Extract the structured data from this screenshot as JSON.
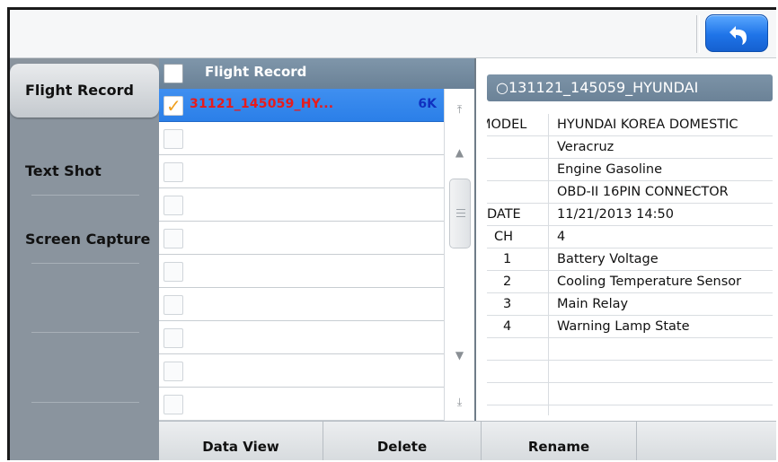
{
  "sidebar": {
    "tabs": [
      {
        "label": "Flight Record",
        "active": true
      },
      {
        "label": "Text Shot",
        "active": false
      },
      {
        "label": "Screen Capture",
        "active": false
      }
    ]
  },
  "list": {
    "header_title": "Flight Record",
    "selected_item": {
      "name": "31121_145059_HY...",
      "size": "6K",
      "checked": true
    }
  },
  "detail": {
    "title": "131121_145059_HYUNDAI",
    "rows": [
      {
        "label": "MODEL",
        "value": "HYUNDAI KOREA DOMESTIC"
      },
      {
        "label": "",
        "value": "Veracruz"
      },
      {
        "label": "",
        "value": "Engine Gasoline"
      },
      {
        "label": "",
        "value": "OBD-II 16PIN CONNECTOR"
      },
      {
        "label": "DATE",
        "value": "11/21/2013 14:50"
      },
      {
        "label": "CH",
        "value": "4"
      },
      {
        "label": "1",
        "value": "Battery Voltage"
      },
      {
        "label": "2",
        "value": "Cooling Temperature Sensor"
      },
      {
        "label": "3",
        "value": "Main Relay"
      },
      {
        "label": "4",
        "value": "Warning Lamp State"
      }
    ]
  },
  "toolbar": {
    "data_view": "Data View",
    "delete": "Delete",
    "rename": "Rename"
  },
  "colors": {
    "accent_blue": "#2b7fe8",
    "sidebar_bg": "#8a949e",
    "header_bg": "#7389a0",
    "file_name_red": "#e81b1b",
    "size_blue": "#1030c0"
  }
}
